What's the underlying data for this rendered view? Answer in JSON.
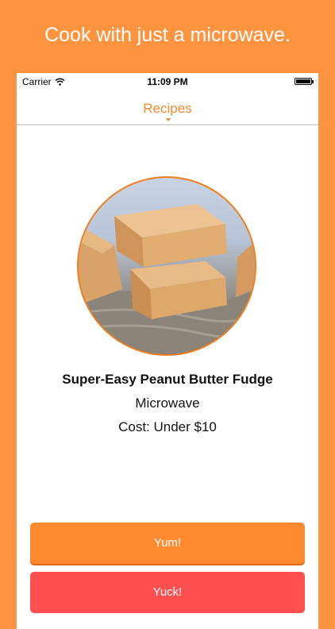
{
  "headline": "Cook with just a microwave.",
  "status_bar": {
    "carrier": "Carrier",
    "time": "11:09 PM"
  },
  "nav": {
    "title": "Recipes"
  },
  "recipe": {
    "title": "Super-Easy Peanut Butter Fudge",
    "method": "Microwave",
    "cost": "Cost: Under $10",
    "image": "peanut-butter-fudge-photo"
  },
  "buttons": {
    "yum": "Yum!",
    "yuck": "Yuck!"
  },
  "colors": {
    "background": "#FF9440",
    "accent": "#F28A30",
    "yum": "#FF8A30",
    "yuck": "#FF4F4F"
  }
}
